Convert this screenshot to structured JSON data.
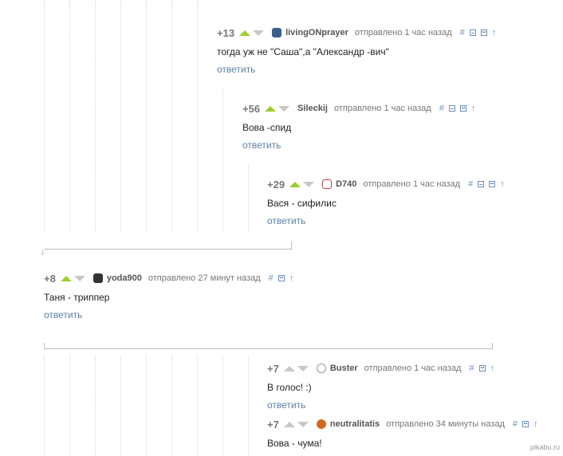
{
  "comments": [
    {
      "rating": "+13",
      "author": "livingONprayer",
      "meta": "отправлено 1 час назад",
      "text": "тогда уж не \"Саша\",а \"Александр -вич\"",
      "reply": "ответить",
      "avatar_color": "#3a5e8c"
    },
    {
      "rating": "+56",
      "author": "Sileckij",
      "meta": "отправлено 1 час назад",
      "text": "Вова -спид",
      "reply": "ответить",
      "avatar_color": ""
    },
    {
      "rating": "+29",
      "author": "D740",
      "meta": "отправлено 1 час назад",
      "text": "Вася - сифилис",
      "reply": "ответить",
      "avatar_color": "#c04040"
    },
    {
      "rating": "+8",
      "author": "yoda900",
      "meta": "отправлено 27 минут назад",
      "text": "Таня - триппер",
      "reply": "ответить",
      "avatar_color": "#333333"
    },
    {
      "rating": "+7",
      "author": "Buster",
      "meta": "отправлено 1 час назад",
      "text": "В голос! :)",
      "reply": "ответить",
      "avatar_color": "#bbbbbb"
    },
    {
      "rating": "+7",
      "author": "neutralitatis",
      "meta": "отправлено 34 минуты назад",
      "text": "Вова - чума!",
      "reply": "",
      "avatar_color": "#d2691e"
    }
  ],
  "icons": {
    "link": "#",
    "collapse": "⊟",
    "save": "save-icon",
    "up": "↑"
  },
  "watermark": "pikabu.ru"
}
